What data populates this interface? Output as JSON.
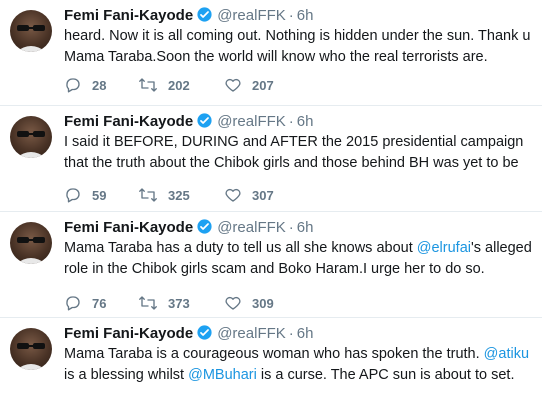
{
  "tweets": [
    {
      "author": "Femi Fani-Kayode",
      "handle": "@realFFK",
      "separator": "·",
      "time": "6h",
      "text_parts": [
        "heard. Now it is all coming out. Nothing is hidden under the sun. Thank u Mama Taraba.Soon the world will know who the real terrorists are."
      ],
      "replies": "28",
      "retweets": "202",
      "likes": "207"
    },
    {
      "author": "Femi Fani-Kayode",
      "handle": "@realFFK",
      "separator": "·",
      "time": "6h",
      "text_parts": [
        "I said it BEFORE, DURING and AFTER the 2015 presidential campaign that the truth about the Chibok girls and those behind BH was yet to be"
      ],
      "replies": "59",
      "retweets": "325",
      "likes": "307"
    },
    {
      "author": "Femi Fani-Kayode",
      "handle": "@realFFK",
      "separator": "·",
      "time": "6h",
      "text_parts": [
        "Mama Taraba has a duty to tell us all she knows about ",
        "@elrufai",
        "'s alleged role in the Chibok girls scam and Boko Haram.I urge her to do so."
      ],
      "replies": "76",
      "retweets": "373",
      "likes": "309"
    },
    {
      "author": "Femi Fani-Kayode",
      "handle": "@realFFK",
      "separator": "·",
      "time": "6h",
      "text_parts": [
        "Mama Taraba is a courageous woman who has spoken the truth. ",
        "@atiku",
        " is a blessing whilst ",
        "@MBuhari",
        " is a curse. The APC sun is about to set."
      ]
    }
  ],
  "icons": {
    "reply": "reply-icon",
    "retweet": "retweet-icon",
    "like": "heart-icon",
    "verified": "verified-badge-icon"
  },
  "colors": {
    "mention": "#1b95e0",
    "verified": "#1da1f2",
    "muted": "#657786",
    "divider": "#e6ecf0"
  }
}
